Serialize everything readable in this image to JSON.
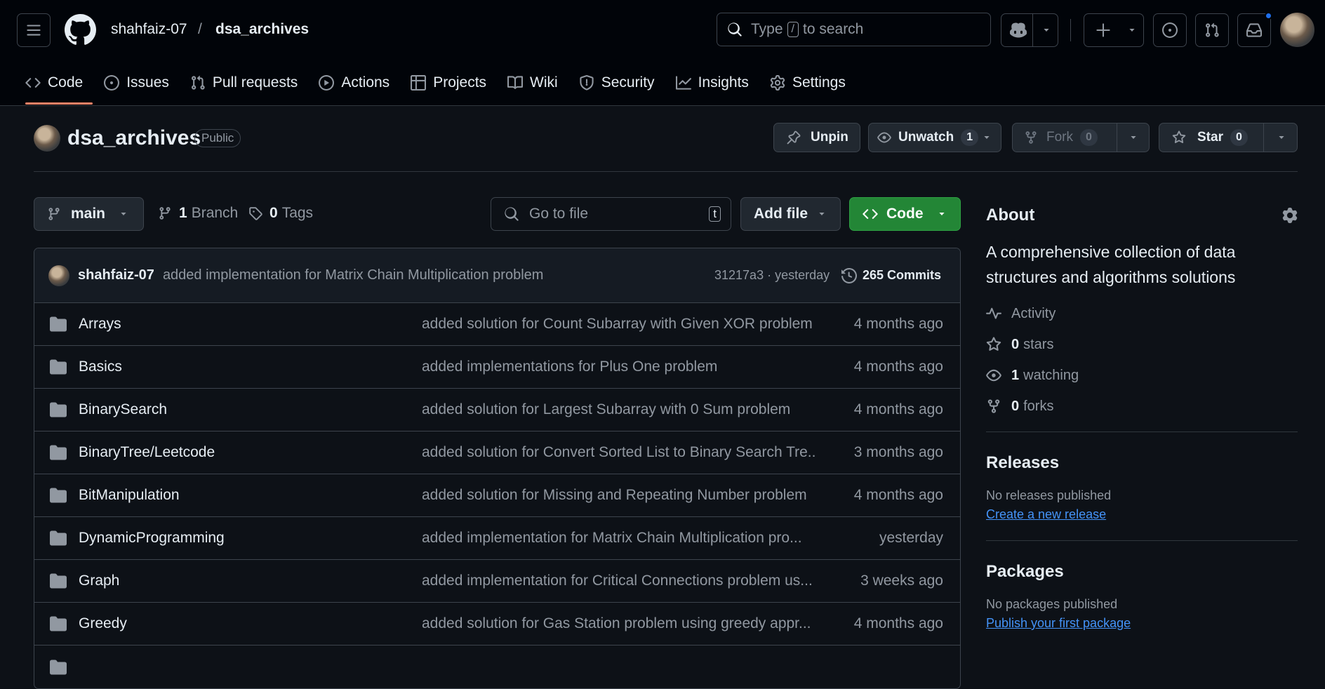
{
  "header": {
    "owner": "shahfaiz-07",
    "separator": "/",
    "repo": "dsa_archives",
    "search_prefix": "Type",
    "search_key": "/",
    "search_suffix": "to search"
  },
  "tabs": [
    {
      "label": "Code",
      "icon": "code-icon",
      "active": true
    },
    {
      "label": "Issues",
      "icon": "issue-icon"
    },
    {
      "label": "Pull requests",
      "icon": "pull-request-icon"
    },
    {
      "label": "Actions",
      "icon": "play-icon"
    },
    {
      "label": "Projects",
      "icon": "table-icon"
    },
    {
      "label": "Wiki",
      "icon": "book-icon"
    },
    {
      "label": "Security",
      "icon": "shield-icon"
    },
    {
      "label": "Insights",
      "icon": "graph-icon"
    },
    {
      "label": "Settings",
      "icon": "gear-icon"
    }
  ],
  "repo_header": {
    "name": "dsa_archives",
    "visibility": "Public",
    "unpin_label": "Unpin",
    "unwatch_label": "Unwatch",
    "watch_count": "1",
    "fork_label": "Fork",
    "fork_count": "0",
    "star_label": "Star",
    "star_count": "0"
  },
  "toolbar": {
    "branch": "main",
    "branch_count": "1",
    "branch_label": "Branch",
    "tag_count": "0",
    "tag_label": "Tags",
    "goto_placeholder": "Go to file",
    "goto_key": "t",
    "add_file_label": "Add file",
    "code_label": "Code"
  },
  "latest_commit": {
    "author": "shahfaiz-07",
    "message": "added implementation for Matrix Chain Multiplication problem",
    "sha_time": "31217a3 · yesterday",
    "commits_label": "265 Commits"
  },
  "files": [
    {
      "name": "Arrays",
      "message": "added solution for Count Subarray with Given XOR problem",
      "age": "4 months ago"
    },
    {
      "name": "Basics",
      "message": "added implementations for Plus One problem",
      "age": "4 months ago"
    },
    {
      "name": "BinarySearch",
      "message": "added solution for Largest Subarray with 0 Sum problem",
      "age": "4 months ago"
    },
    {
      "name": "BinaryTree/Leetcode",
      "message": "added solution for Convert Sorted List to Binary Search Tre...",
      "age": "3 months ago"
    },
    {
      "name": "BitManipulation",
      "message": "added solution for Missing and Repeating Number problem",
      "age": "4 months ago"
    },
    {
      "name": "DynamicProgramming",
      "message": "added implementation for Matrix Chain Multiplication pro...",
      "age": "yesterday"
    },
    {
      "name": "Graph",
      "message": "added implementation for Critical Connections problem us...",
      "age": "3 weeks ago"
    },
    {
      "name": "Greedy",
      "message": "added solution for Gas Station problem using greedy appr...",
      "age": "4 months ago"
    }
  ],
  "about": {
    "title": "About",
    "description": "A comprehensive collection of data structures and algorithms solutions",
    "activity_label": "Activity",
    "stars_count": "0",
    "stars_label": "stars",
    "watching_count": "1",
    "watching_label": "watching",
    "forks_count": "0",
    "forks_label": "forks"
  },
  "releases": {
    "title": "Releases",
    "empty": "No releases published",
    "link": "Create a new release"
  },
  "packages": {
    "title": "Packages",
    "empty": "No packages published",
    "link": "Publish your first package"
  },
  "colors": {
    "accent_green": "#238636",
    "tab_underline": "#f78166",
    "link": "#4493f8",
    "notification_dot": "#1f6feb"
  }
}
